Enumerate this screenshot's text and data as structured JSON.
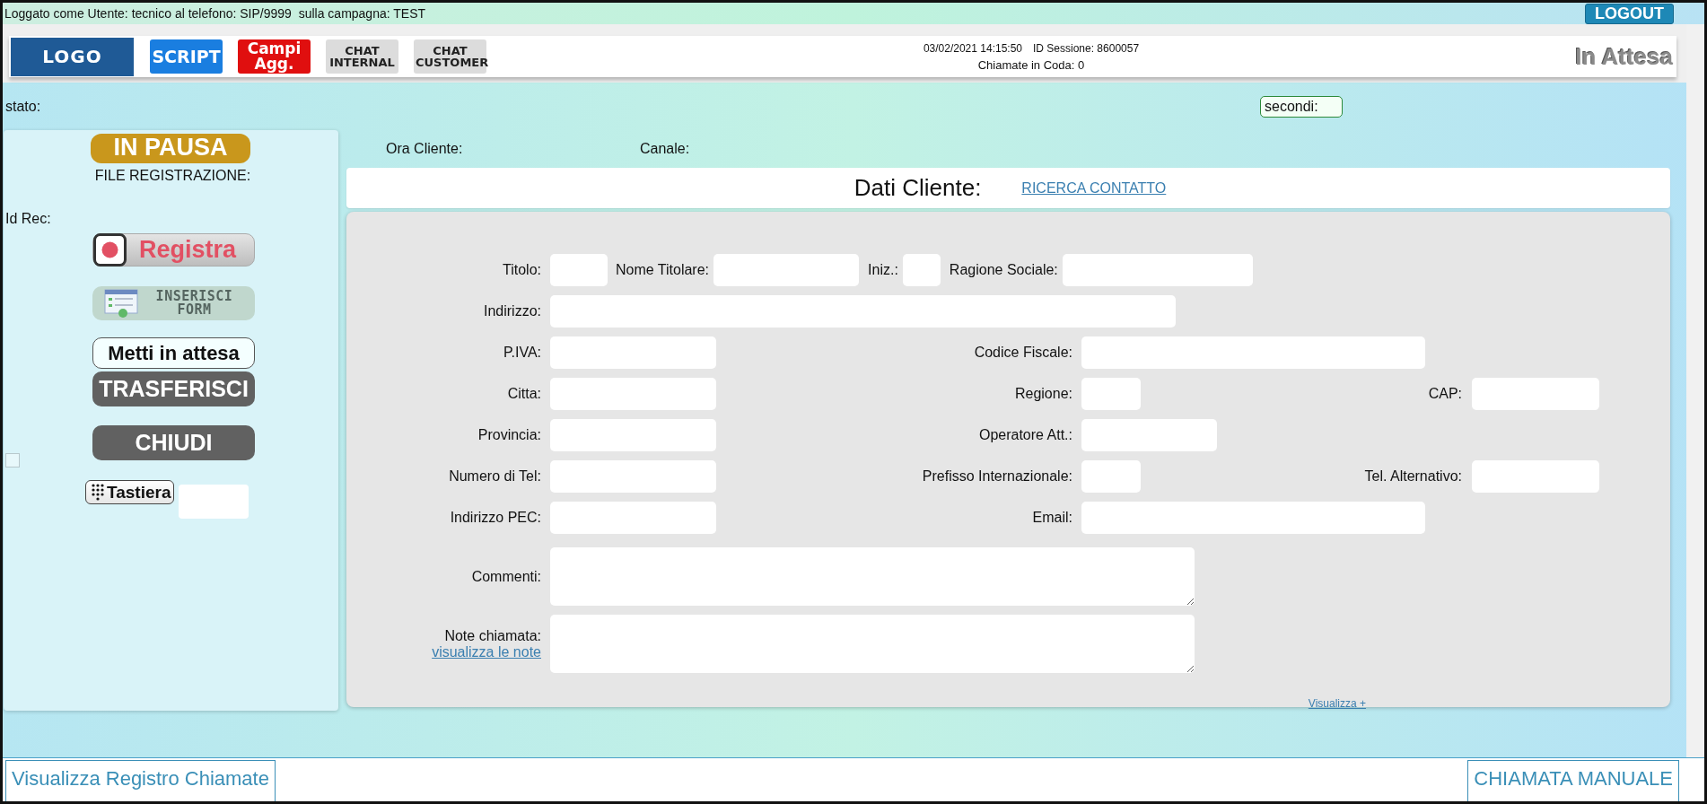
{
  "top_bar": {
    "login_info": "Loggato come Utente: tecnico al telefono: SIP/9999  sulla campagna: TEST",
    "logout": "LOGOUT"
  },
  "header": {
    "logo": "LOGO",
    "buttons": [
      {
        "label": "SCRIPT",
        "color": "#1a7ee0"
      },
      {
        "label": "Campi Agg.",
        "color": "#e00f0f"
      },
      {
        "label": "CHAT INTERNAL",
        "color": "#dcdcdc"
      },
      {
        "label": "CHAT CUSTOMER",
        "color": "#dcdcdc"
      }
    ],
    "datetime": "03/02/2021 14:15:50",
    "session": "ID Sessione: 8600057",
    "queue": "Chiamate in Coda: 0",
    "status": "In Attesa"
  },
  "status_row": {
    "stato": "stato:",
    "secondi": "secondi:"
  },
  "left_panel": {
    "pause_badge": "IN PAUSA",
    "file_label": "FILE REGISTRAZIONE:",
    "id_rec_label": "Id Rec:",
    "actions": [
      {
        "kind": "record",
        "label": "Registra",
        "disabled": false
      },
      {
        "kind": "form",
        "label": "INSERISCI FORM",
        "disabled": true
      },
      {
        "kind": "outline",
        "label": "Metti in attesa",
        "disabled": false
      },
      {
        "kind": "dark",
        "label": "TRASFERISCI",
        "disabled": false
      },
      {
        "kind": "dark",
        "label": "CHIUDI",
        "disabled": false
      }
    ],
    "checkbox": {
      "checked": false
    },
    "keypad": "Tastiera"
  },
  "info_row": {
    "ora_cliente": "Ora Cliente:",
    "canale": "Canale:"
  },
  "client_header": {
    "title": "Dati Cliente:",
    "search_link": "RICERCA CONTATTO"
  },
  "form": {
    "rows": [
      [
        {
          "label": "Titolo:",
          "kind": "text"
        },
        {
          "label": "Nome Titolare:",
          "kind": "text"
        },
        {
          "label": "Iniz.:",
          "kind": "text"
        },
        {
          "label": "Ragione Sociale:",
          "kind": "text"
        }
      ],
      [
        {
          "label": "Indirizzo:",
          "kind": "text"
        }
      ],
      [
        {
          "label": "P.IVA:",
          "kind": "text"
        },
        {
          "label": "Codice Fiscale:",
          "kind": "text"
        }
      ],
      [
        {
          "label": "Citta:",
          "kind": "text"
        },
        {
          "label": "Regione:",
          "kind": "text"
        },
        {
          "label": "CAP:",
          "kind": "text"
        }
      ],
      [
        {
          "label": "Provincia:",
          "kind": "text"
        },
        {
          "label": "Operatore Att.:",
          "kind": "text"
        }
      ],
      [
        {
          "label": "Numero di Tel:",
          "kind": "text"
        },
        {
          "label": "Prefisso Internazionale:",
          "kind": "text"
        },
        {
          "label": "Tel. Alternativo:",
          "kind": "text"
        }
      ],
      [
        {
          "label": "Indirizzo PEC:",
          "kind": "text"
        },
        {
          "label": "Email:",
          "kind": "text"
        }
      ],
      [
        {
          "label": "Commenti:",
          "kind": "area"
        }
      ],
      [
        {
          "label": "Note chiamata:",
          "kind": "area",
          "link": "visualizza le note"
        }
      ]
    ],
    "more_link": "Visualizza +"
  },
  "footer": {
    "log_button": "Visualizza Registro Chiamate",
    "manual_call": "CHIAMATA MANUALE"
  }
}
